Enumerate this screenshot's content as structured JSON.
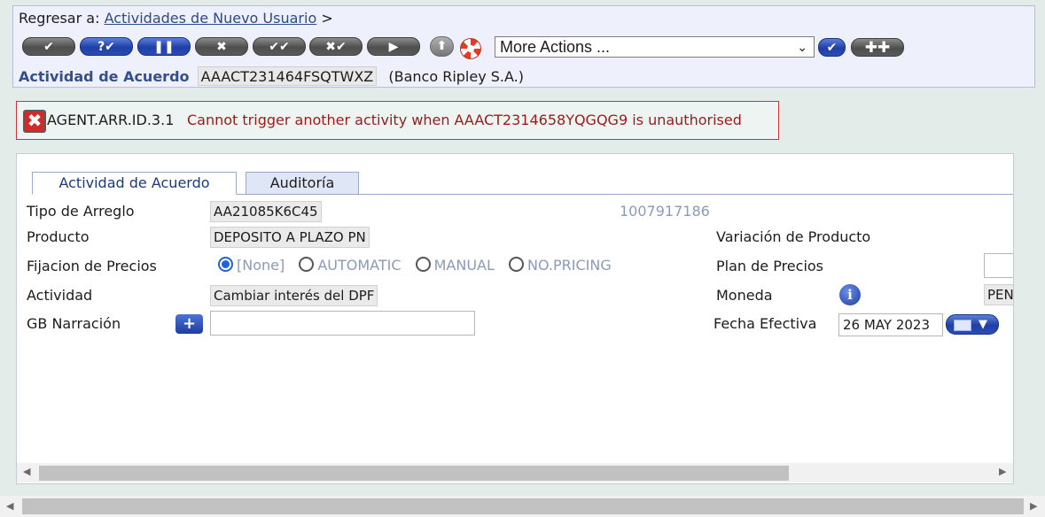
{
  "header": {
    "back_prefix": "Regresar a:",
    "back_link": "Actividades de Nuevo Usuario",
    "back_suffix": ">",
    "toolbar": {
      "buttons": [
        {
          "name": "validate",
          "glyph": "✔"
        },
        {
          "name": "help-validate",
          "glyph": "?✔"
        },
        {
          "name": "hold",
          "glyph": "❚❚"
        },
        {
          "name": "cancel",
          "glyph": "✖"
        },
        {
          "name": "authorise",
          "glyph": "✔✔"
        },
        {
          "name": "reverse",
          "glyph": "✖✔"
        },
        {
          "name": "next",
          "glyph": "▶"
        }
      ],
      "up_glyph": "⬆",
      "more_actions": "More Actions ...",
      "chevron": "⌄",
      "go_glyph": "✔",
      "plus_glyph": "✚✚"
    },
    "acuerdo_label": "Actividad de Acuerdo",
    "acuerdo_id": "AAACT231464FSQTWXZ",
    "acuerdo_bank": "(Banco Ripley S.A.)"
  },
  "error": {
    "icon_glyph": "✖",
    "code": "AGENT.ARR.ID.3.1",
    "message": "Cannot trigger another activity when AAACT2314658YQGQG9 is unauthorised"
  },
  "tabs": [
    {
      "label": "Actividad de Acuerdo"
    },
    {
      "label": "Auditoría"
    }
  ],
  "form": {
    "tipo_label": "Tipo de Arreglo",
    "tipo_value": "AA21085K6C45",
    "customer_id": "1007917186",
    "producto_label": "Producto",
    "producto_value": "DEPOSITO A PLAZO PN",
    "variacion_label": "Variación de Producto",
    "fijacion_label": "Fijacion de Precios",
    "pricing_options": [
      "[None]",
      "AUTOMATIC",
      "MANUAL",
      "NO.PRICING"
    ],
    "pricing_selected": "[None]",
    "plan_label": "Plan de Precios",
    "actividad_label": "Actividad",
    "actividad_value": "Cambiar interés del DPF",
    "moneda_label": "Moneda",
    "info_glyph": "i",
    "moneda_value": "PEN",
    "narracion_label": "GB Narración",
    "narracion_plus": "+",
    "narracion_value": "",
    "fecha_label": "Fecha Efectiva",
    "fecha_value": "26 MAY 2023",
    "cal_arrow": "▼"
  },
  "scroll": {
    "left": "◀",
    "right": "▶"
  }
}
